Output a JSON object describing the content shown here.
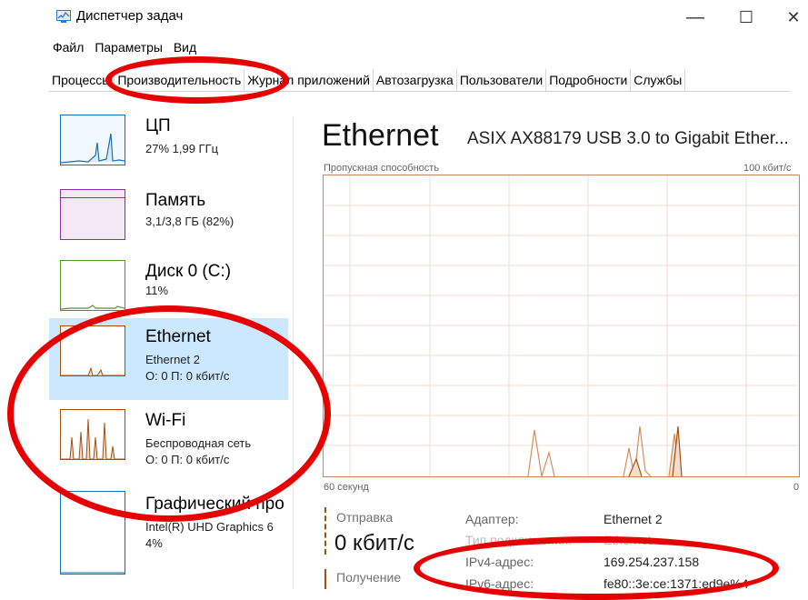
{
  "window": {
    "title": "Диспетчер задач",
    "minimize": "—",
    "maximize": "☐",
    "close": "✕"
  },
  "menu": [
    "Файл",
    "Параметры",
    "Вид"
  ],
  "tabs": [
    "Процессы",
    "Производительность",
    "Журнал приложений",
    "Автозагрузка",
    "Пользователи",
    "Подробности",
    "Службы"
  ],
  "active_tab": "Производительность",
  "sidebar": [
    {
      "title": "ЦП",
      "sub1": "27% 1,99 ГГц",
      "sub2": "",
      "color": "#1b6fb3"
    },
    {
      "title": "Память",
      "sub1": "3,1/3,8 ГБ (82%)",
      "sub2": "",
      "color": "#8c2fa6"
    },
    {
      "title": "Диск 0 (C:)",
      "sub1": "11%",
      "sub2": "",
      "color": "#4d9a29"
    },
    {
      "title": "Ethernet",
      "sub1": "Ethernet 2",
      "sub2": "О: 0 П: 0 кбит/с",
      "color": "#a74f11",
      "selected": true
    },
    {
      "title": "Wi-Fi",
      "sub1": "Беспроводная сеть",
      "sub2": "О: 0 П: 0 кбит/с",
      "color": "#a74f11"
    },
    {
      "title": "Графический про",
      "sub1": "Intel(R) UHD Graphics 6",
      "sub2": "4%",
      "color": "#1b6fb3"
    }
  ],
  "main": {
    "title": "Ethernet",
    "adapter_name": "ASIX AX88179 USB 3.0 to Gigabit Ether...",
    "graph_top_left": "Пропускная способность",
    "graph_top_right": "100 кбит/с",
    "graph_bottom_left": "60 секунд",
    "graph_bottom_right": "0",
    "graph_color": "#a74f11"
  },
  "stats": {
    "send_label": "Отправка",
    "send_value": "0 кбит/с",
    "recv_label": "Получение"
  },
  "info": [
    {
      "label": "Адаптер:",
      "value": "Ethernet 2"
    },
    {
      "label": "Тип подключения:",
      "value": "Ethernet"
    },
    {
      "label": "IPv4-адрес:",
      "value": "169.254.237.158"
    },
    {
      "label": "IPv6-адрес:",
      "value": "fe80::3e:ce:1371:ed9e%4"
    }
  ]
}
